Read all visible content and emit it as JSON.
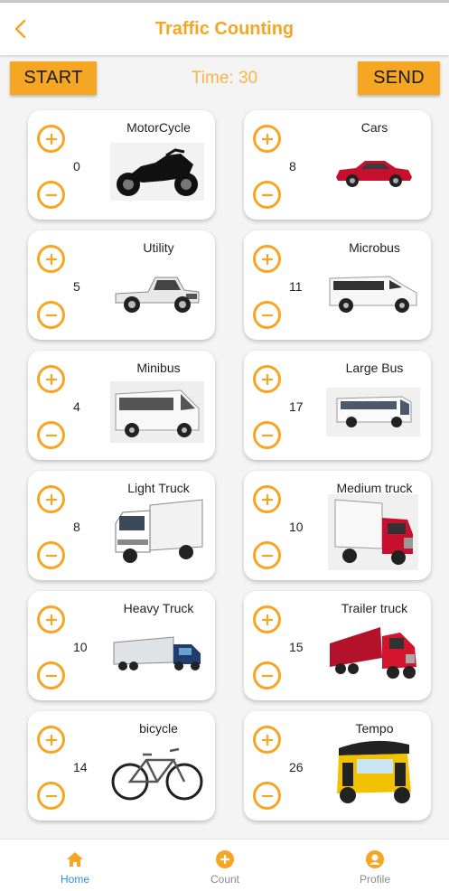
{
  "header": {
    "title": "Traffic Counting"
  },
  "controls": {
    "start_label": "START",
    "send_label": "SEND",
    "timer_text": "Time: 30"
  },
  "colors": {
    "accent": "#f5a623",
    "active_nav": "#2f8fe0",
    "background": "#f4f4f4"
  },
  "vehicles": [
    {
      "name": "MotorCycle",
      "count": "0",
      "image": "motorcycle-image"
    },
    {
      "name": "Cars",
      "count": "8",
      "image": "car-image"
    },
    {
      "name": "Utility",
      "count": "5",
      "image": "pickup-truck-image"
    },
    {
      "name": "Microbus",
      "count": "11",
      "image": "microbus-van-image"
    },
    {
      "name": "Minibus",
      "count": "4",
      "image": "minibus-image"
    },
    {
      "name": "Large Bus",
      "count": "17",
      "image": "large-bus-image"
    },
    {
      "name": "Light Truck",
      "count": "8",
      "image": "light-truck-image"
    },
    {
      "name": "Medium truck",
      "count": "10",
      "image": "medium-truck-image"
    },
    {
      "name": "Heavy Truck",
      "count": "10",
      "image": "heavy-truck-image"
    },
    {
      "name": "Trailer truck",
      "count": "15",
      "image": "trailer-truck-image"
    },
    {
      "name": "bicycle",
      "count": "14",
      "image": "bicycle-image"
    },
    {
      "name": "Tempo",
      "count": "26",
      "image": "tempo-rickshaw-image"
    }
  ],
  "bottom_nav": [
    {
      "label": "Home",
      "icon": "home-icon",
      "active": true
    },
    {
      "label": "Count",
      "icon": "plus-circle-icon",
      "active": false
    },
    {
      "label": "Profile",
      "icon": "user-circle-icon",
      "active": false
    }
  ]
}
